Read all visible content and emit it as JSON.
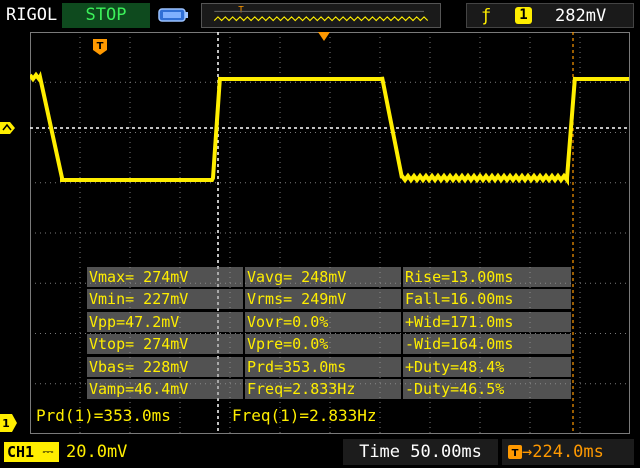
{
  "topbar": {
    "brand": "RIGOL",
    "run_state": "STOP",
    "trigger_edge_icon": "rising-edge-icon",
    "trigger_channel": "1",
    "trigger_level": "282mV"
  },
  "measurements": [
    [
      "Vmax= 274mV",
      "Vavg= 248mV",
      "Rise=13.00ms"
    ],
    [
      "Vmin= 227mV",
      "Vrms= 249mV",
      "Fall=16.00ms"
    ],
    [
      "Vpp=47.2mV",
      "Vovr=0.0%",
      "+Wid=171.0ms"
    ],
    [
      "Vtop= 274mV",
      "Vpre=0.0%",
      "-Wid=164.0ms"
    ],
    [
      "Vbas= 228mV",
      "Prd=353.0ms",
      "+Duty=48.4%"
    ],
    [
      "Vamp=46.4mV",
      "Freq=2.833Hz",
      "-Duty=46.5%"
    ]
  ],
  "cursor": {
    "period": "Prd(1)=353.0ms",
    "frequency": "Freq(1)=2.833Hz"
  },
  "bottombar": {
    "channel": "CH1",
    "coupling_icon": "dc-coupling-icon",
    "vertical_scale": "20.0mV",
    "timebase": "Time 50.00ms",
    "trigger_offset": "→224.0ms"
  },
  "colors": {
    "trace": "#ffee00",
    "run_state_text": "#3cf05a",
    "trigger_marker": "#ff9900",
    "grid": "#7a7a7a"
  }
}
